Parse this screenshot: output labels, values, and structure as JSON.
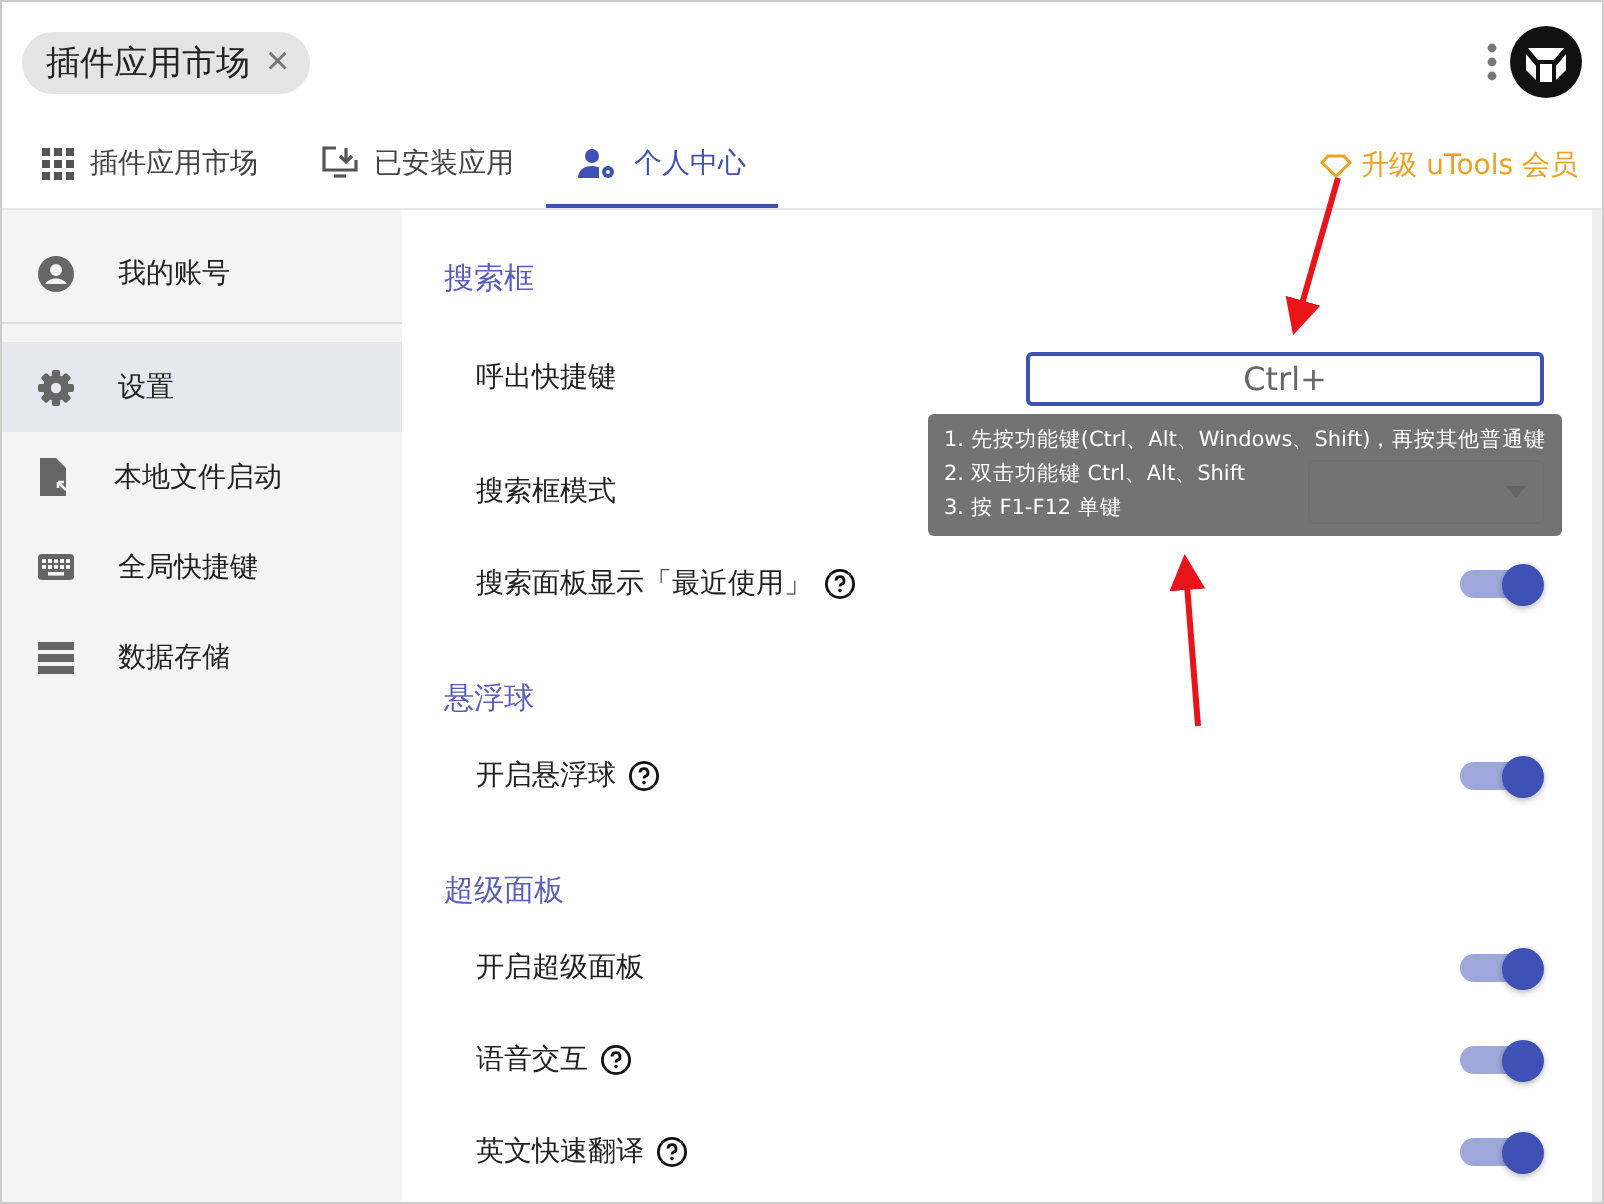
{
  "top_tab": {
    "label": "插件应用市场",
    "close": "×"
  },
  "nav_tabs": [
    {
      "label": "插件应用市场",
      "selected": false
    },
    {
      "label": "已安装应用",
      "selected": false
    },
    {
      "label": "个人中心",
      "selected": true
    }
  ],
  "upgrade_link": "升级 uTools 会员",
  "sidebar": {
    "items": [
      {
        "label": "我的账号",
        "selected": false
      },
      {
        "label": "设置",
        "selected": true
      },
      {
        "label": "本地文件启动",
        "selected": false
      },
      {
        "label": "全局快捷键",
        "selected": false
      },
      {
        "label": "数据存储",
        "selected": false
      }
    ]
  },
  "sections": [
    {
      "title": "搜索框",
      "rows": [
        {
          "kind": "shortcut",
          "label": "呼出快捷键",
          "value": "Ctrl+",
          "tooltip": [
            "1. 先按功能键(Ctrl、Alt、Windows、Shift)，再按其他普通键",
            "2. 双击功能键 Ctrl、Alt、Shift",
            "3. 按 F1-F12 单键"
          ]
        },
        {
          "kind": "select",
          "label": "搜索框模式"
        },
        {
          "kind": "toggle",
          "label": "搜索面板显示「最近使用」",
          "help": true,
          "on": true
        }
      ]
    },
    {
      "title": "悬浮球",
      "rows": [
        {
          "kind": "toggle",
          "label": "开启悬浮球",
          "help": true,
          "on": true
        }
      ]
    },
    {
      "title": "超级面板",
      "rows": [
        {
          "kind": "toggle",
          "label": "开启超级面板",
          "help": false,
          "on": true
        },
        {
          "kind": "toggle",
          "label": "语音交互",
          "help": true,
          "on": true
        },
        {
          "kind": "toggle",
          "label": "英文快速翻译",
          "help": true,
          "on": true
        }
      ]
    }
  ]
}
